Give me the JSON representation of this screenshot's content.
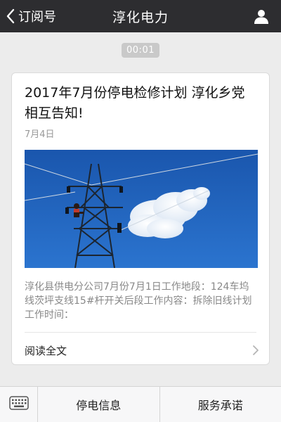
{
  "navbar": {
    "back_label": "订阅号",
    "title": "淳化电力",
    "back_icon": "chevron-left-icon",
    "profile_icon": "person-icon"
  },
  "message": {
    "time": "00:01"
  },
  "article": {
    "title": "2017年7月份停电检修计划 淳化乡党相互告知!",
    "date": "7月4日",
    "summary": "淳化县供电分公司7月份7月1日工作地段：124车坞线茨坪支线15#杆开关后段工作内容：拆除旧线计划工作时间：",
    "read_more": "阅读全文",
    "cover_colors": {
      "sky": "#1f5fb8",
      "cloud": "#ffffff"
    }
  },
  "menubar": {
    "keyboard_icon": "keyboard-icon",
    "items": [
      {
        "label": "停电信息"
      },
      {
        "label": "服务承诺"
      }
    ]
  }
}
